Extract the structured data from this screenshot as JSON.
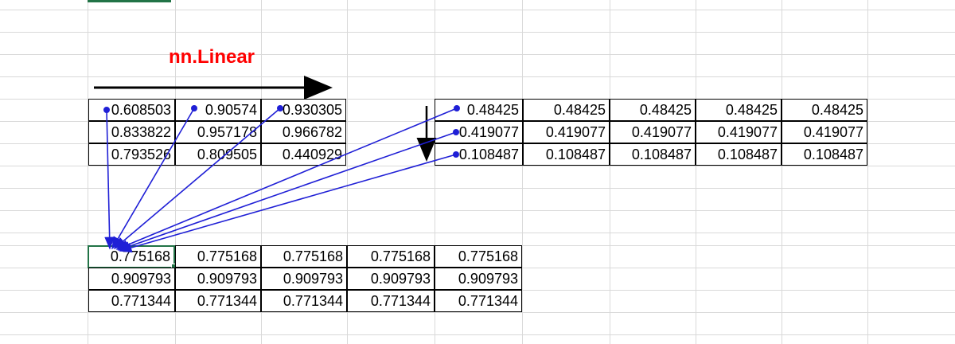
{
  "title": "nn.Linear",
  "colors": {
    "title": "#ff0000",
    "arrow_blue": "#1f1fd6",
    "arrow_black": "#000000",
    "selection": "#217346"
  },
  "input_matrix": [
    [
      "0.608503",
      "0.90574",
      "0.930305"
    ],
    [
      "0.833822",
      "0.957178",
      "0.966782"
    ],
    [
      "0.793526",
      "0.809505",
      "0.440929"
    ]
  ],
  "bias_matrix": [
    [
      "0.48425",
      "0.48425",
      "0.48425",
      "0.48425",
      "0.48425"
    ],
    [
      "0.419077",
      "0.419077",
      "0.419077",
      "0.419077",
      "0.419077"
    ],
    [
      "0.108487",
      "0.108487",
      "0.108487",
      "0.108487",
      "0.108487"
    ]
  ],
  "output_matrix": [
    [
      "0.775168",
      "0.775168",
      "0.775168",
      "0.775168",
      "0.775168"
    ],
    [
      "0.909793",
      "0.909793",
      "0.909793",
      "0.909793",
      "0.909793"
    ],
    [
      "0.771344",
      "0.771344",
      "0.771344",
      "0.771344",
      "0.771344"
    ]
  ],
  "active_cell": "output-r0-c0"
}
